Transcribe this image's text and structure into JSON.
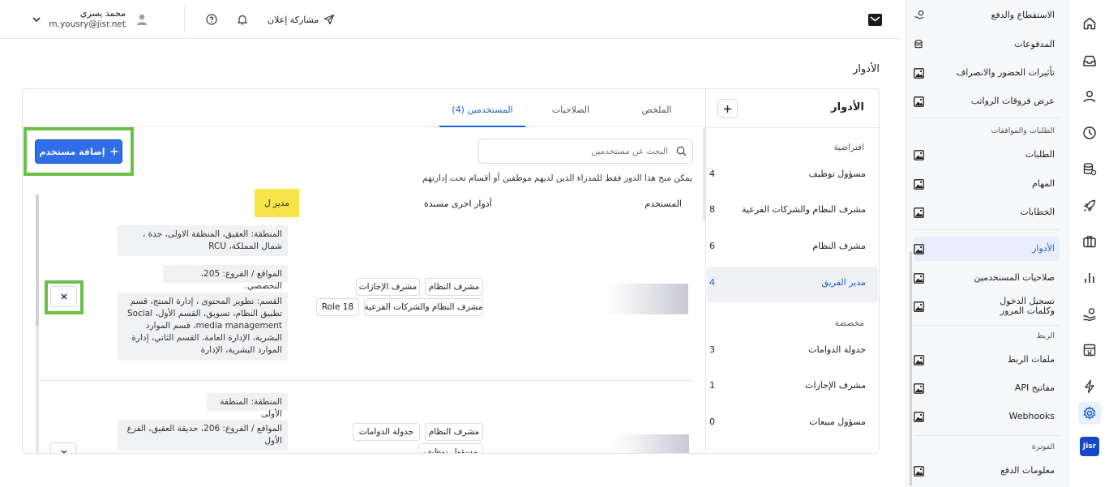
{
  "topbar": {
    "user_name": "محمد يسري",
    "user_email": "m.yousry@jisr.net",
    "share_label": "مشاركة إعلان"
  },
  "page": {
    "title": "الأدوار"
  },
  "rail": {
    "items": [
      "home-icon",
      "inbox-icon",
      "person-icon",
      "clock-icon",
      "coins-icon",
      "rocket-icon",
      "briefcase-icon",
      "chart-icon",
      "hand-coin-icon",
      "building-icon",
      "lightning-icon",
      "settings-icon"
    ],
    "logo": "Jisr"
  },
  "sidebar": {
    "items": [
      {
        "label": "الاستقطاع والدفع"
      },
      {
        "label": "المدفوعات"
      },
      {
        "label": "تأثيرات الحضور والانصراف"
      },
      {
        "label": "عرض فروقات الرواتب"
      },
      {
        "label": "الطلبات"
      },
      {
        "label": "المهام"
      },
      {
        "label": "الخطابات"
      },
      {
        "label": "الأدوار"
      },
      {
        "label": "صلاحيات المستخدمين"
      },
      {
        "label": "تسجيل الدخول وكلمات المرور"
      },
      {
        "label": "ملفات الربط"
      },
      {
        "label": "مفاتيح API"
      },
      {
        "label": "Webhooks"
      },
      {
        "label": "معلومات الدفع"
      }
    ],
    "sections": {
      "requests": "الطلبات والموافقات",
      "integration": "الربط",
      "billing": "الفوترة"
    }
  },
  "roles_panel": {
    "title": "الأدوار",
    "default_heading": "افتراضية",
    "custom_heading": "مخصصة",
    "default_roles": [
      {
        "name": "مسؤول توظيف",
        "count": "4"
      },
      {
        "name": "مشرف النظام والشركات الفرعية",
        "count": "8"
      },
      {
        "name": "مشرف النظام",
        "count": "6"
      },
      {
        "name": "مدير الفريق",
        "count": "4"
      }
    ],
    "custom_roles": [
      {
        "name": "جدولة الدوامات",
        "count": "3"
      },
      {
        "name": "مشرف الإجازات",
        "count": "1"
      },
      {
        "name": "مسؤول مبيعات",
        "count": "0"
      }
    ]
  },
  "tabs": [
    {
      "label": "الملخص"
    },
    {
      "label": "الصلاحيات"
    },
    {
      "label": "المستخدمين (4)"
    }
  ],
  "users": {
    "search_placeholder": "البحث عن مستخدمين",
    "add_user_label": "إضافة مستخدم",
    "notice": "يمكن منح هذا الدور فقط للمدراء الذين لديهم موظفين أو أقسام تحت إدارتهم",
    "col_user": "المستخدم",
    "col_other_roles": "أدوار اخرى مسندة",
    "manager_badge": "مدير ل",
    "row1": {
      "roles": [
        "مشرف النظام",
        "مشرف الإجازات",
        "مشرف النظام والشركات الفرعية",
        "Role 18"
      ],
      "region": "المنطقة: العقيق، المنطقة الاولى، جدة ، شمال المملكة، RCU",
      "locations": "المواقع / الفروع: 205، التخصصي.",
      "departments": "القسم: تطوير المحتوى ، إدارة المنتج، قسم تطبيق النظام، تسويق، القسم الأول، Social media management، قسم الموارد البشرية، الإدارة العامة، القسم الثاني، إدارة الموارد البشرية، الإدارة"
    },
    "row2": {
      "roles": [
        "مشرف النظام",
        "جدولة الدوامات",
        "مسؤول توظيف"
      ],
      "region": "المنطقة: المنطقة الأولى",
      "locations": "المواقع / الفروع: 206، حديقة العقيق، الفرع الأول"
    }
  }
}
